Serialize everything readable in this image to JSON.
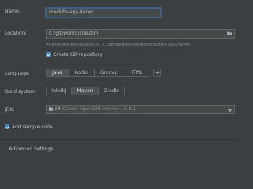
{
  "name": {
    "label": "Name:",
    "value": "mockito-spy-demo"
  },
  "location": {
    "label": "Location:",
    "value": "C:\\git\\work\\hs\\testim",
    "hint": "Project will be created in: C:\\git\\work\\hs\\testim\\mockito-spy-demo"
  },
  "git": {
    "label": "Create Git repository",
    "checked": true
  },
  "language": {
    "label": "Language:",
    "options": [
      "Java",
      "Kotlin",
      "Groovy",
      "HTML"
    ],
    "selected": "Java",
    "add_label": "+"
  },
  "build_system": {
    "label": "Build system:",
    "options": [
      "IntelliJ",
      "Maven",
      "Gradle"
    ],
    "selected": "Maven"
  },
  "jdk": {
    "label": "JDK:",
    "name": "19",
    "version": "Oracle OpenJDK version 19.0.1"
  },
  "sample_code": {
    "label": "Add sample code",
    "checked": true
  },
  "advanced": {
    "label": "Advanced Settings"
  },
  "colors": {
    "background": "#3c3f41",
    "accent": "#4a88c7",
    "focus_border": "#3d6185"
  }
}
